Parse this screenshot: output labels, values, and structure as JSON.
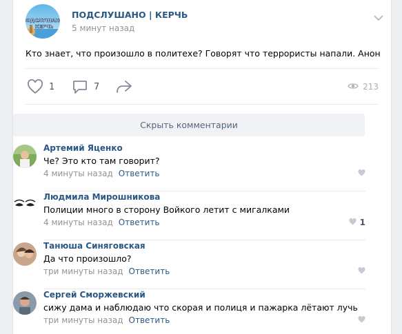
{
  "post": {
    "group_name": "ПОДСЛУШАНО | КЕРЧЬ",
    "time": "5 минут назад",
    "avatar_text_top": "ПОДСЛУШАНО",
    "avatar_text_bottom": "КЕРЧЬ",
    "text": "Кто знает, что произошло в политехе? Говорят что террористы напали. Анон",
    "likes": "1",
    "comments": "7",
    "views": "213"
  },
  "comments_block": {
    "hide_label": "Скрыть комментарии",
    "reply_label": "Ответить",
    "items": [
      {
        "author": "Артемий Яценко",
        "text": "Че? Это кто там говорит?",
        "time": "4 минуты назад",
        "likes": ""
      },
      {
        "author": "Людмила Мирошникова",
        "text": "Полиции много в сторону Войкого летит с мигалками",
        "time": "4 минуты назад",
        "likes": "1"
      },
      {
        "author": "Танюша Синяговская",
        "text": "Да что произошло?",
        "time": "три минуты назад",
        "likes": ""
      },
      {
        "author": "Сергей Сморжевский",
        "text": "сижу дама и наблюдаю что скорая и полиця и пажарка лётают лучь",
        "time": "три минуты назад",
        "likes": ""
      }
    ]
  },
  "colors": {
    "link": "#2a5885",
    "muted": "#939393",
    "icon": "#828a99",
    "background": "#edeef0"
  }
}
